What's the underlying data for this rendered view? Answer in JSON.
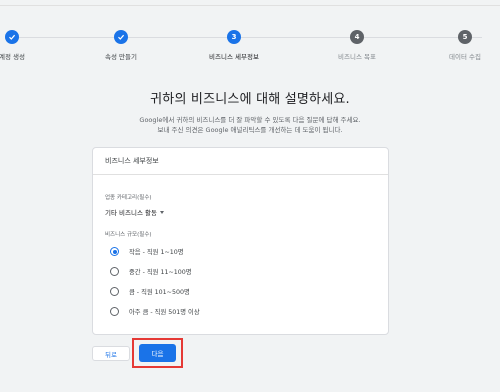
{
  "stepper": {
    "steps": [
      {
        "label": "계정 생성",
        "number": "1",
        "state": "done"
      },
      {
        "label": "속성 만들기",
        "number": "2",
        "state": "done"
      },
      {
        "label": "비즈니스 세부정보",
        "number": "3",
        "state": "current"
      },
      {
        "label": "비즈니스 목표",
        "number": "4",
        "state": "todo"
      },
      {
        "label": "데이터 수집",
        "number": "5",
        "state": "todo"
      }
    ]
  },
  "page": {
    "heading": "귀하의 비즈니스에 대해 설명하세요.",
    "description_line1": "Google에서 귀하의 비즈니스를 더 잘 파악할 수 있도록 다음 질문에 답해 주세요.",
    "description_line2": "보내 주신 의견은 Google 애널리틱스를 개선하는 데 도움이 됩니다."
  },
  "card": {
    "title": "비즈니스 세부정보",
    "category_label": "업종 카테고리(필수)",
    "category_value": "기타 비즈니스 활동",
    "size_label": "비즈니스 규모(필수)",
    "size_options": [
      {
        "label": "작음 - 직원 1~10명",
        "checked": true
      },
      {
        "label": "중간 - 직원 11~100명",
        "checked": false
      },
      {
        "label": "큼 - 직원 101~500명",
        "checked": false
      },
      {
        "label": "아주 큼 - 직원 501명 이상",
        "checked": false
      }
    ]
  },
  "buttons": {
    "back_label": "뒤로",
    "next_label": "다음"
  },
  "colors": {
    "accent": "#1a73e8",
    "highlight": "#e53935",
    "background": "#f1f3f4"
  }
}
